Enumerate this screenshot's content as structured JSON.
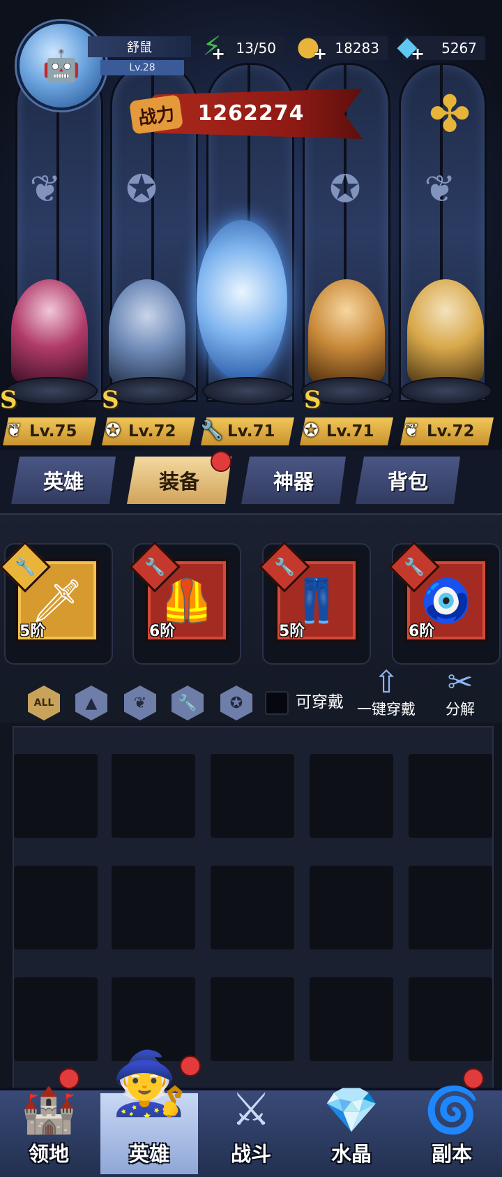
{
  "player": {
    "name": "舒鼠",
    "level": "Lv.28",
    "avatar_icon": "robot-avatar-icon"
  },
  "resources": {
    "stamina": {
      "value": "13/50",
      "icon": "lightning-icon",
      "color": "#3fbf4a"
    },
    "gold": {
      "value": "18283",
      "icon": "coin-icon",
      "color": "#e8b53a"
    },
    "diamond": {
      "value": "5267",
      "icon": "diamond-icon",
      "color": "#5fc8f2"
    }
  },
  "power": {
    "label": "战力",
    "value": "1262274"
  },
  "heroes": [
    {
      "rank": "S",
      "level": "Lv.75",
      "class_icon": "wing-icon",
      "color": "#b03a6a"
    },
    {
      "rank": "S",
      "level": "Lv.72",
      "class_icon": "beast-crest-icon",
      "color": "#6f8bb8"
    },
    {
      "rank": "",
      "level": "Lv.71",
      "class_icon": "wrench-icon",
      "color": "#7fb5ef"
    },
    {
      "rank": "S",
      "level": "Lv.71",
      "class_icon": "beast-crest-icon",
      "color": "#c98a3a"
    },
    {
      "rank": "",
      "level": "Lv.72",
      "class_icon": "wing-icon",
      "color": "#d8a84a"
    }
  ],
  "tabs": [
    {
      "label": "英雄",
      "active": false
    },
    {
      "label": "装备",
      "active": true,
      "badge": true
    },
    {
      "label": "神器",
      "active": false
    },
    {
      "label": "背包",
      "active": false
    }
  ],
  "equipment": [
    {
      "grade": "5阶",
      "rarity": "gold",
      "item_icon": "sword-icon"
    },
    {
      "grade": "6阶",
      "rarity": "red",
      "item_icon": "armor-icon"
    },
    {
      "grade": "5阶",
      "rarity": "red",
      "item_icon": "pants-icon"
    },
    {
      "grade": "6阶",
      "rarity": "red",
      "item_icon": "amulet-icon"
    }
  ],
  "filters": {
    "items": [
      {
        "label": "ALL",
        "icon": "all-filter-icon"
      },
      {
        "label": "",
        "icon": "wizard-hat-icon"
      },
      {
        "label": "",
        "icon": "wing-icon"
      },
      {
        "label": "",
        "icon": "wrench-icon"
      },
      {
        "label": "",
        "icon": "beast-crest-icon"
      }
    ],
    "wearable_label": "可穿戴",
    "auto_equip_label": "一键穿戴",
    "decompose_label": "分解"
  },
  "bottom_nav": [
    {
      "label": "领地",
      "icon": "castle-icon",
      "badge": true,
      "active": false
    },
    {
      "label": "英雄",
      "icon": "wizard-hat-icon",
      "badge": true,
      "active": true
    },
    {
      "label": "战斗",
      "icon": "sword-book-icon",
      "badge": false,
      "active": false
    },
    {
      "label": "水晶",
      "icon": "crystal-icon",
      "badge": false,
      "active": false
    },
    {
      "label": "副本",
      "icon": "portal-icon",
      "badge": true,
      "active": false
    }
  ]
}
